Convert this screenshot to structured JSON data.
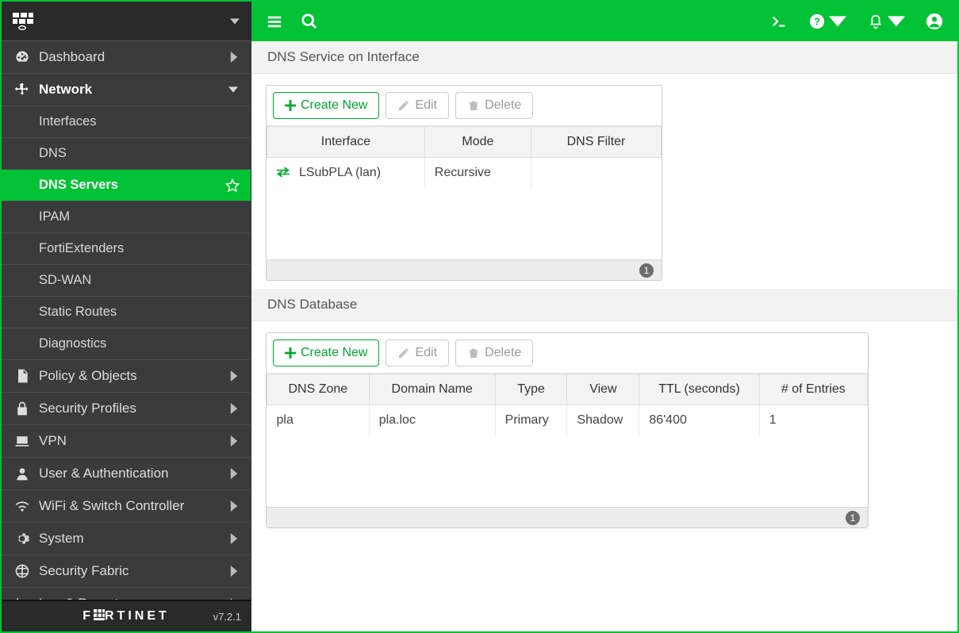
{
  "sidebar": {
    "categories": [
      {
        "label": "Dashboard",
        "expanded": false,
        "icon": "gauge"
      },
      {
        "label": "Network",
        "expanded": true,
        "icon": "move",
        "items": [
          "Interfaces",
          "DNS",
          "DNS Servers",
          "IPAM",
          "FortiExtenders",
          "SD-WAN",
          "Static Routes",
          "Diagnostics"
        ],
        "active_index": 2
      },
      {
        "label": "Policy & Objects",
        "expanded": false,
        "icon": "doc"
      },
      {
        "label": "Security Profiles",
        "expanded": false,
        "icon": "lock"
      },
      {
        "label": "VPN",
        "expanded": false,
        "icon": "laptop"
      },
      {
        "label": "User & Authentication",
        "expanded": false,
        "icon": "user"
      },
      {
        "label": "WiFi & Switch Controller",
        "expanded": false,
        "icon": "wifi"
      },
      {
        "label": "System",
        "expanded": false,
        "icon": "gear"
      },
      {
        "label": "Security Fabric",
        "expanded": false,
        "icon": "fabric"
      },
      {
        "label": "Log & Report",
        "expanded": false,
        "icon": "chart"
      }
    ],
    "brand": "FORTINET",
    "version": "v7.2.1"
  },
  "section1": {
    "title": "DNS Service on Interface",
    "toolbar": {
      "create": "Create New",
      "edit": "Edit",
      "delete": "Delete"
    },
    "columns": [
      "Interface",
      "Mode",
      "DNS Filter"
    ],
    "rows": [
      {
        "interface": "LSubPLA (lan)",
        "mode": "Recursive",
        "filter": ""
      }
    ],
    "count": "1"
  },
  "section2": {
    "title": "DNS Database",
    "toolbar": {
      "create": "Create New",
      "edit": "Edit",
      "delete": "Delete"
    },
    "columns": [
      "DNS Zone",
      "Domain Name",
      "Type",
      "View",
      "TTL (seconds)",
      "# of Entries"
    ],
    "rows": [
      {
        "zone": "pla",
        "domain": "pla.loc",
        "type": "Primary",
        "view": "Shadow",
        "ttl": "86'400",
        "entries": "1"
      }
    ],
    "count": "1"
  }
}
